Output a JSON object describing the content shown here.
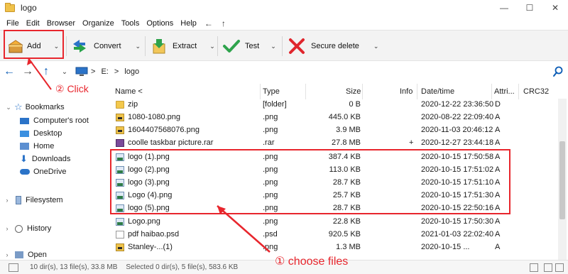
{
  "window": {
    "title": "logo",
    "minimize": "—",
    "maximize": "☐",
    "close": "✕"
  },
  "menu": {
    "items": [
      "File",
      "Edit",
      "Browser",
      "Organize",
      "Tools",
      "Options",
      "Help"
    ],
    "back_arrow": "←",
    "up_arrow": "↑"
  },
  "toolbar": {
    "add_label": "Add",
    "convert_label": "Convert",
    "extract_label": "Extract",
    "test_label": "Test",
    "secure_delete_label": "Secure delete"
  },
  "address": {
    "path": [
      "E:",
      "logo"
    ],
    "sep": ">"
  },
  "sidebar": {
    "bookmarks": "Bookmarks",
    "items": [
      "Computer's root",
      "Desktop",
      "Home",
      "Downloads",
      "OneDrive"
    ],
    "filesystem": "Filesystem",
    "history": "History",
    "open": "Open"
  },
  "columns": {
    "name": "Name <",
    "type": "Type",
    "size": "Size",
    "info": "Info",
    "datetime": "Date/time",
    "attrib": "Attri...",
    "crc": "CRC32"
  },
  "files": [
    {
      "name": "zip",
      "type": "[folder]",
      "size": "0 B",
      "info": "",
      "date": "2020-12-22 23:36:50",
      "attr": "D",
      "icon": "folder"
    },
    {
      "name": "1080-1080.png",
      "type": ".png",
      "size": "445.0 KB",
      "info": "",
      "date": "2020-08-22 22:09:40",
      "attr": "A",
      "icon": "png"
    },
    {
      "name": "1604407568076.png",
      "type": ".png",
      "size": "3.9 MB",
      "info": "",
      "date": "2020-11-03 20:46:12",
      "attr": "A",
      "icon": "png"
    },
    {
      "name": "coolle taskbar picture.rar",
      "type": ".rar",
      "size": "27.8 MB",
      "info": "+",
      "date": "2020-12-27 23:44:18",
      "attr": "A",
      "icon": "rar"
    },
    {
      "name": "logo (1).png",
      "type": ".png",
      "size": "387.4 KB",
      "info": "",
      "date": "2020-10-15 17:50:58",
      "attr": "A",
      "icon": "logo"
    },
    {
      "name": "logo (2).png",
      "type": ".png",
      "size": "113.0 KB",
      "info": "",
      "date": "2020-10-15 17:51:02",
      "attr": "A",
      "icon": "logo"
    },
    {
      "name": "logo (3).png",
      "type": ".png",
      "size": "28.7 KB",
      "info": "",
      "date": "2020-10-15 17:51:10",
      "attr": "A",
      "icon": "logo"
    },
    {
      "name": "Logo (4).png",
      "type": ".png",
      "size": "25.7 KB",
      "info": "",
      "date": "2020-10-15 17:51:30",
      "attr": "A",
      "icon": "logo"
    },
    {
      "name": "logo (5).png",
      "type": ".png",
      "size": "28.7 KB",
      "info": "",
      "date": "2020-10-15 22:50:16",
      "attr": "A",
      "icon": "logo"
    },
    {
      "name": "Logo.png",
      "type": ".png",
      "size": "22.8 KB",
      "info": "",
      "date": "2020-10-15 17:50:30",
      "attr": "A",
      "icon": "logo"
    },
    {
      "name": "pdf haibao.psd",
      "type": ".psd",
      "size": "920.5 KB",
      "info": "",
      "date": "2021-01-03 22:02:40",
      "attr": "A",
      "icon": "psd"
    },
    {
      "name": "Stanley-...(1)",
      "type": ".png",
      "size": "1.3 MB",
      "info": "",
      "date": "2020-10-15 ...",
      "attr": "A",
      "icon": "png"
    }
  ],
  "status": {
    "left": "10 dir(s), 13 file(s), 33.8 MB",
    "right": "Selected 0 dir(s), 5 file(s), 583.6 KB"
  },
  "annotations": {
    "click": "② Click",
    "choose": "① choose files"
  },
  "colors": {
    "accent_red": "#e8262d",
    "link_blue": "#0b5cb5"
  }
}
